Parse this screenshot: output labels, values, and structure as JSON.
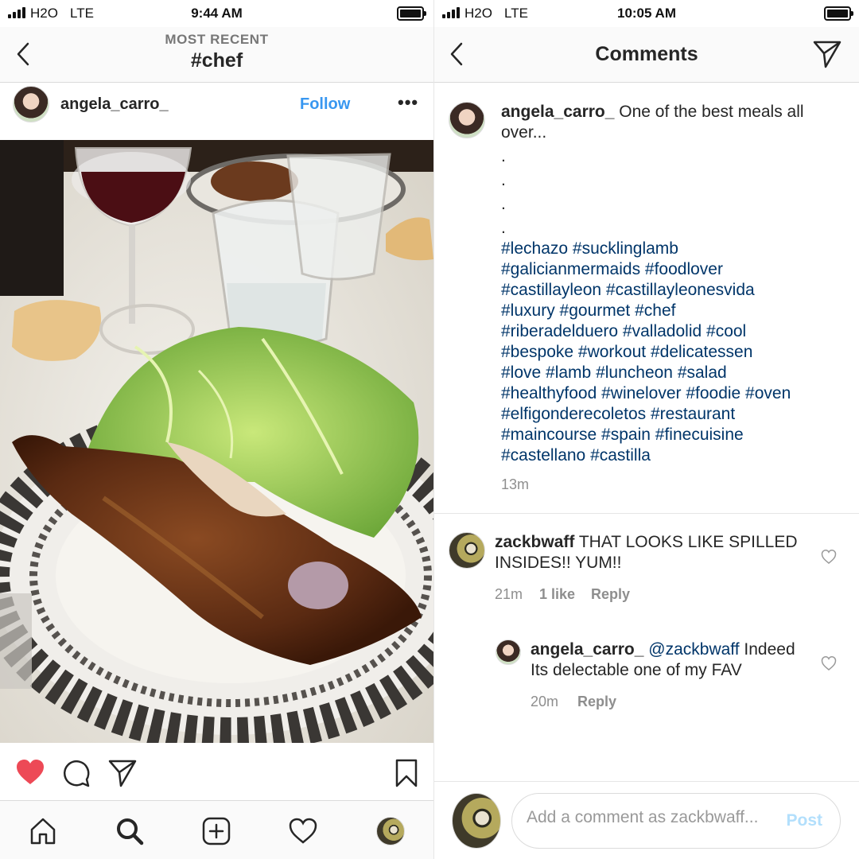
{
  "left": {
    "status": {
      "carrier": "H2O",
      "network": "LTE",
      "time": "9:44 AM"
    },
    "header": {
      "subtitle": "MOST RECENT",
      "title": "#chef"
    },
    "post": {
      "username": "angela_carro_",
      "follow_label": "Follow",
      "more_label": "•••",
      "liked": true
    },
    "tabbar": [
      "home-icon",
      "search-icon",
      "add-post-icon",
      "activity-heart-icon",
      "profile-avatar"
    ]
  },
  "right": {
    "status": {
      "carrier": "H2O",
      "network": "LTE",
      "time": "10:05 AM"
    },
    "header": {
      "title": "Comments"
    },
    "caption": {
      "username": "angela_carro_",
      "text_line1": "One of the best meals all",
      "text_line2": "over...",
      "dots": [
        ".",
        ".",
        ".",
        "."
      ],
      "hashtag_lines": [
        "#lechazo #sucklinglamb",
        "#galicianmermaids #foodlover",
        "#castillayleon #castillayleonesvida",
        "#luxury #gourmet #chef",
        "#riberadelduero #valladolid #cool",
        "#bespoke #workout #delicatessen",
        "#love #lamb #luncheon #salad",
        "#healthyfood #winelover #foodie #oven",
        "#elfigonderecoletos #restaurant",
        "#maincourse #spain #finecuisine",
        "#castellano #castilla"
      ],
      "time": "13m"
    },
    "comments": [
      {
        "username": "zackbwaff",
        "text_line1": "THAT LOOKS LIKE SPILLED",
        "text_line2": "INSIDES!! YUM!!",
        "time": "21m",
        "likes": "1 like",
        "reply": "Reply"
      },
      {
        "username": "angela_carro_",
        "mention": "@zackbwaff",
        "text_line1": "Indeed",
        "text_line2": "Its delectable one of my FAV",
        "time": "20m",
        "reply": "Reply"
      }
    ],
    "add_comment": {
      "placeholder": "Add a comment as zackbwaff...",
      "post_label": "Post"
    }
  },
  "colors": {
    "link_blue": "#3897f0",
    "hashtag_navy": "#003569",
    "like_red": "#ed4956",
    "post_disabled": "#b2dffc"
  }
}
